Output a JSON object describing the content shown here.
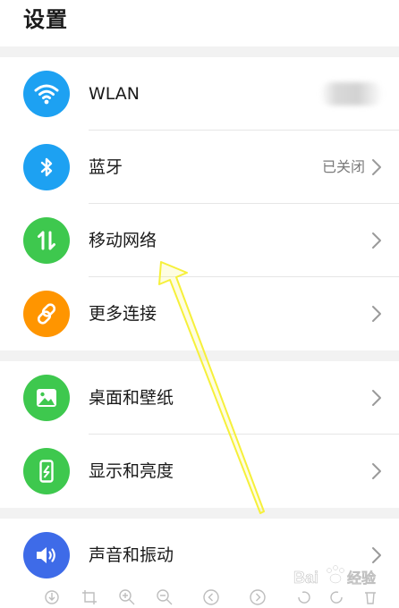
{
  "header": {
    "title": "设置"
  },
  "colors": {
    "wlan": "#1da1f2",
    "bluetooth": "#1da1f2",
    "mobile": "#3ec84e",
    "more": "#ff9500",
    "wallpaper": "#3ec84e",
    "display": "#3ec84e",
    "sound": "#3e6be8",
    "arrow": "#f6f03a"
  },
  "groups": [
    {
      "items": [
        {
          "label": "WLAN",
          "icon": "wifi-icon",
          "status": ""
        },
        {
          "label": "蓝牙",
          "icon": "bluetooth-icon",
          "status": "已关闭"
        },
        {
          "label": "移动网络",
          "icon": "mobile-data-icon",
          "status": ""
        },
        {
          "label": "更多连接",
          "icon": "link-icon",
          "status": ""
        }
      ]
    },
    {
      "items": [
        {
          "label": "桌面和壁纸",
          "icon": "image-icon",
          "status": ""
        },
        {
          "label": "显示和亮度",
          "icon": "phone-brightness-icon",
          "status": ""
        }
      ]
    },
    {
      "items": [
        {
          "label": "声音和振动",
          "icon": "speaker-icon",
          "status": ""
        }
      ]
    }
  ],
  "watermark": {
    "text": "Bai 经验"
  }
}
